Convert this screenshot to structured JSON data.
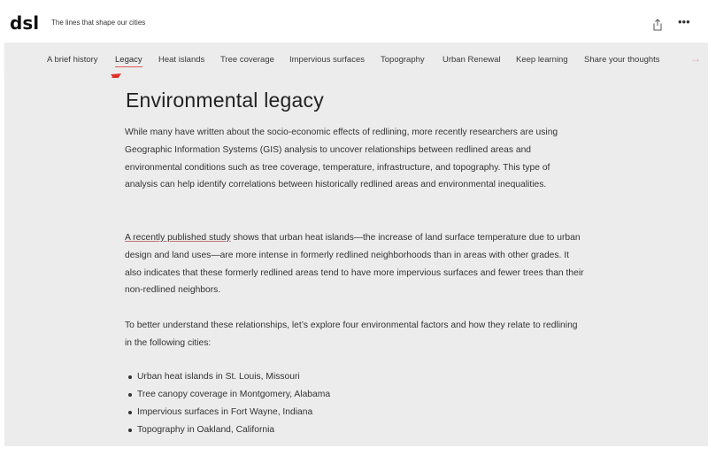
{
  "header": {
    "logo_text": "dsl",
    "tagline": "The lines that shape our cities",
    "share_icon": "share-icon",
    "more_label": "•••"
  },
  "nav": {
    "items": [
      {
        "label": "A brief history"
      },
      {
        "label": "Legacy",
        "active": true
      },
      {
        "label": "Heat islands"
      },
      {
        "label": "Tree coverage"
      },
      {
        "label": "Impervious surfaces"
      },
      {
        "label": "Topography"
      },
      {
        "label": "Urban Renewal"
      },
      {
        "label": "Keep learning"
      },
      {
        "label": "Share your thoughts"
      }
    ],
    "next_arrow": "→",
    "accent_color": "#e05a5a"
  },
  "annotation": {
    "arrow_color": "#e0312a"
  },
  "content": {
    "title": "Environmental legacy",
    "paragraph1": "While many have written about the socio-economic effects of redlining, more recently researchers are using Geographic Information Systems (GIS) analysis to uncover relationships between redlined areas and environmental conditions such as tree coverage, temperature, infrastructure, and topography.  This type of analysis can help identify correlations between historically redlined areas and environmental inequalities.",
    "paragraph2_link": "A recently published study",
    "paragraph2_rest": " shows that urban heat islands—the increase of land surface temperature due to urban design and land uses—are more intense in formerly redlined neighborhoods than in areas with other grades. It also indicates that these formerly redlined areas tend to have more impervious surfaces and fewer trees than their non-redlined neighbors.",
    "paragraph3": "To better understand these relationships, let’s explore four environmental factors and how they relate to redlining in the following cities:",
    "bullets": [
      "Urban heat islands in St. Louis, Missouri",
      "Tree canopy coverage in Montgomery, Alabama",
      "Impervious surfaces in Fort Wayne, Indiana",
      "Topography in Oakland, California"
    ]
  }
}
